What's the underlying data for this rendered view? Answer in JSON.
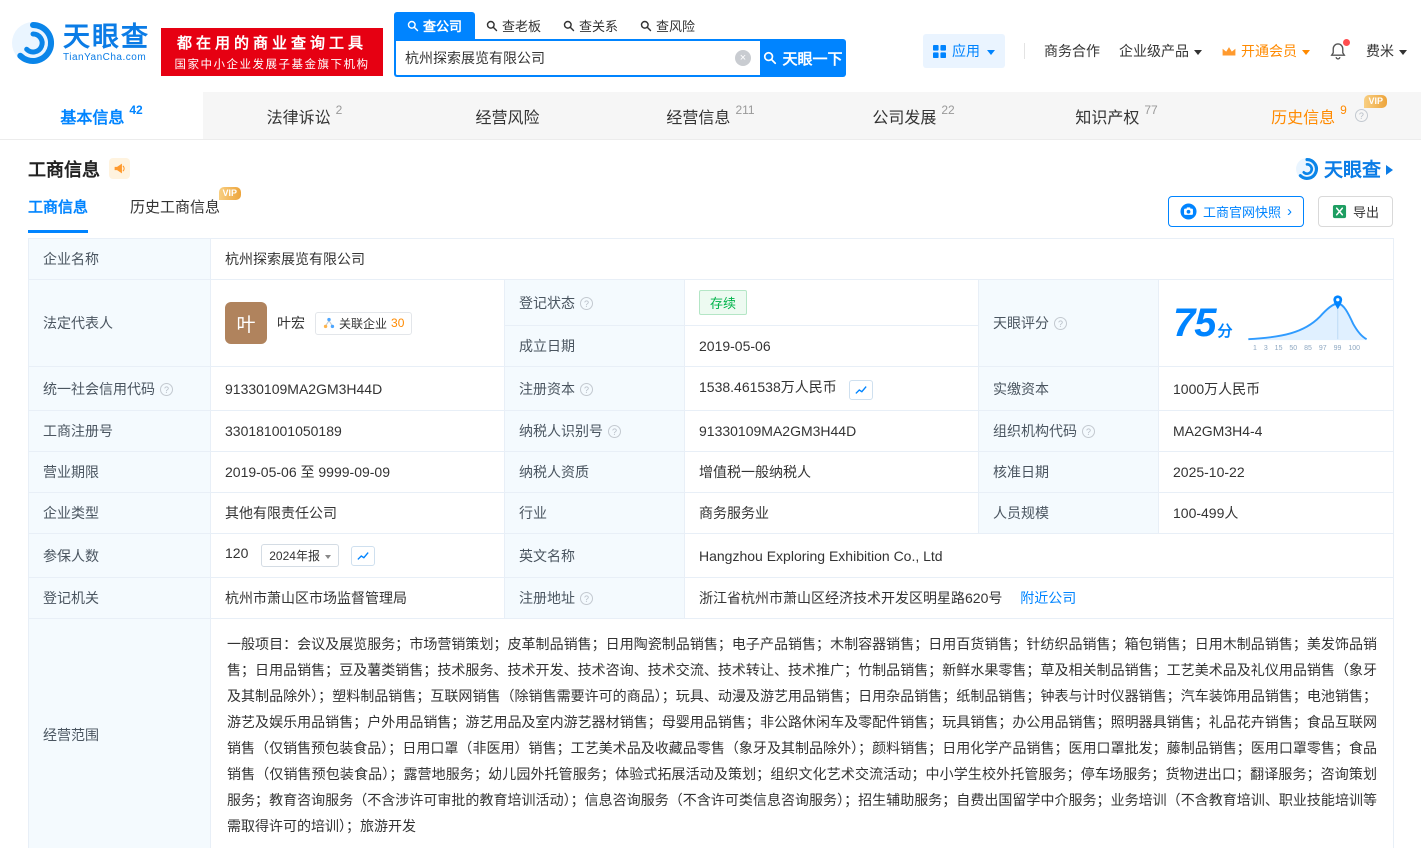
{
  "colors": {
    "brand_blue": "#0084ff",
    "banner_red": "#e60012",
    "vip_orange": "#ff8a00",
    "status_green": "#00b34a"
  },
  "header": {
    "logo_title": "天眼查",
    "logo_domain": "TianYanCha.com",
    "banner_line1": "都在用的商业查询工具",
    "banner_line2": "国家中小企业发展子基金旗下机构",
    "search_tabs": [
      {
        "label": "查公司"
      },
      {
        "label": "查老板"
      },
      {
        "label": "查关系"
      },
      {
        "label": "查风险"
      }
    ],
    "search_value": "杭州探索展览有限公司",
    "search_button": "天眼一下",
    "menu_apps": "应用",
    "menu_cooperation": "商务合作",
    "menu_enterprise": "企业级产品",
    "menu_vip": "开通会员",
    "menu_user": "费米"
  },
  "nav_tabs": [
    {
      "label": "基本信息",
      "count": "42"
    },
    {
      "label": "法律诉讼",
      "count": "2"
    },
    {
      "label": "经营风险",
      "count": ""
    },
    {
      "label": "经营信息",
      "count": "211"
    },
    {
      "label": "公司发展",
      "count": "22"
    },
    {
      "label": "知识产权",
      "count": "77"
    },
    {
      "label": "历史信息",
      "count": "9"
    }
  ],
  "section": {
    "title": "工商信息",
    "brand": "天眼查",
    "subtab_current": "工商信息",
    "subtab_history": "历史工商信息",
    "vip_badge": "VIP",
    "snapshot_button": "工商官网快照",
    "export_button": "导出"
  },
  "fields": {
    "company_name_label": "企业名称",
    "company_name": "杭州探索展览有限公司",
    "legal_rep_label": "法定代表人",
    "avatar_char": "叶",
    "legal_rep_name": "叶宏",
    "related_label": "关联企业",
    "related_count": "30",
    "status_label": "登记状态",
    "status_value": "存续",
    "established_label": "成立日期",
    "established_value": "2019-05-06",
    "score_label": "天眼评分",
    "score_value": "75",
    "score_unit": "分",
    "score_axis": "1 3 15 50 85 97 99 100",
    "credit_code_label": "统一社会信用代码",
    "credit_code": "91330109MA2GM3H44D",
    "reg_capital_label": "注册资本",
    "reg_capital": "1538.461538万人民币",
    "paid_capital_label": "实缴资本",
    "paid_capital": "1000万人民币",
    "reg_number_label": "工商注册号",
    "reg_number": "330181001050189",
    "taxpayer_id_label": "纳税人识别号",
    "taxpayer_id": "91330109MA2GM3H44D",
    "org_code_label": "组织机构代码",
    "org_code": "MA2GM3H4-4",
    "term_label": "营业期限",
    "term_value": "2019-05-06 至 9999-09-09",
    "taxpayer_quality_label": "纳税人资质",
    "taxpayer_quality": "增值税一般纳税人",
    "approval_date_label": "核准日期",
    "approval_date": "2025-10-22",
    "company_type_label": "企业类型",
    "company_type": "其他有限责任公司",
    "industry_label": "行业",
    "industry_value": "商务服务业",
    "staff_size_label": "人员规模",
    "staff_size": "100-499人",
    "insured_label": "参保人数",
    "insured_value": "120",
    "annual_report_tag": "2024年报",
    "english_name_label": "英文名称",
    "english_name": "Hangzhou Exploring Exhibition Co., Ltd",
    "registry_label": "登记机关",
    "registry_value": "杭州市萧山区市场监督管理局",
    "address_label": "注册地址",
    "address_value": "浙江省杭州市萧山区经济技术开发区明星路620号",
    "nearby_link": "附近公司",
    "scope_label": "经营范围",
    "scope_text": "一般项目：会议及展览服务；市场营销策划；皮革制品销售；日用陶瓷制品销售；电子产品销售；木制容器销售；日用百货销售；针纺织品销售；箱包销售；日用木制品销售；美发饰品销售；日用品销售；豆及薯类销售；技术服务、技术开发、技术咨询、技术交流、技术转让、技术推广；竹制品销售；新鲜水果零售；草及相关制品销售；工艺美术品及礼仪用品销售（象牙及其制品除外）；塑料制品销售；互联网销售（除销售需要许可的商品）；玩具、动漫及游艺用品销售；日用杂品销售；纸制品销售；钟表与计时仪器销售；汽车装饰用品销售；电池销售；游艺及娱乐用品销售；户外用品销售；游艺用品及室内游艺器材销售；母婴用品销售；非公路休闲车及零配件销售；玩具销售；办公用品销售；照明器具销售；礼品花卉销售；食品互联网销售（仅销售预包装食品）；日用口罩（非医用）销售；工艺美术品及收藏品零售（象牙及其制品除外）；颜料销售；日用化学产品销售；医用口罩批发；藤制品销售；医用口罩零售；食品销售（仅销售预包装食品）；露营地服务；幼儿园外托管服务；体验式拓展活动及策划；组织文化艺术交流活动；中小学生校外托管服务；停车场服务；货物进出口；翻译服务；咨询策划服务；教育咨询服务（不含涉许可审批的教育培训活动）；信息咨询服务（不含许可类信息咨询服务）；招生辅助服务；自费出国留学中介服务；业务培训（不含教育培训、职业技能培训等需取得许可的培训）；旅游开发"
  }
}
